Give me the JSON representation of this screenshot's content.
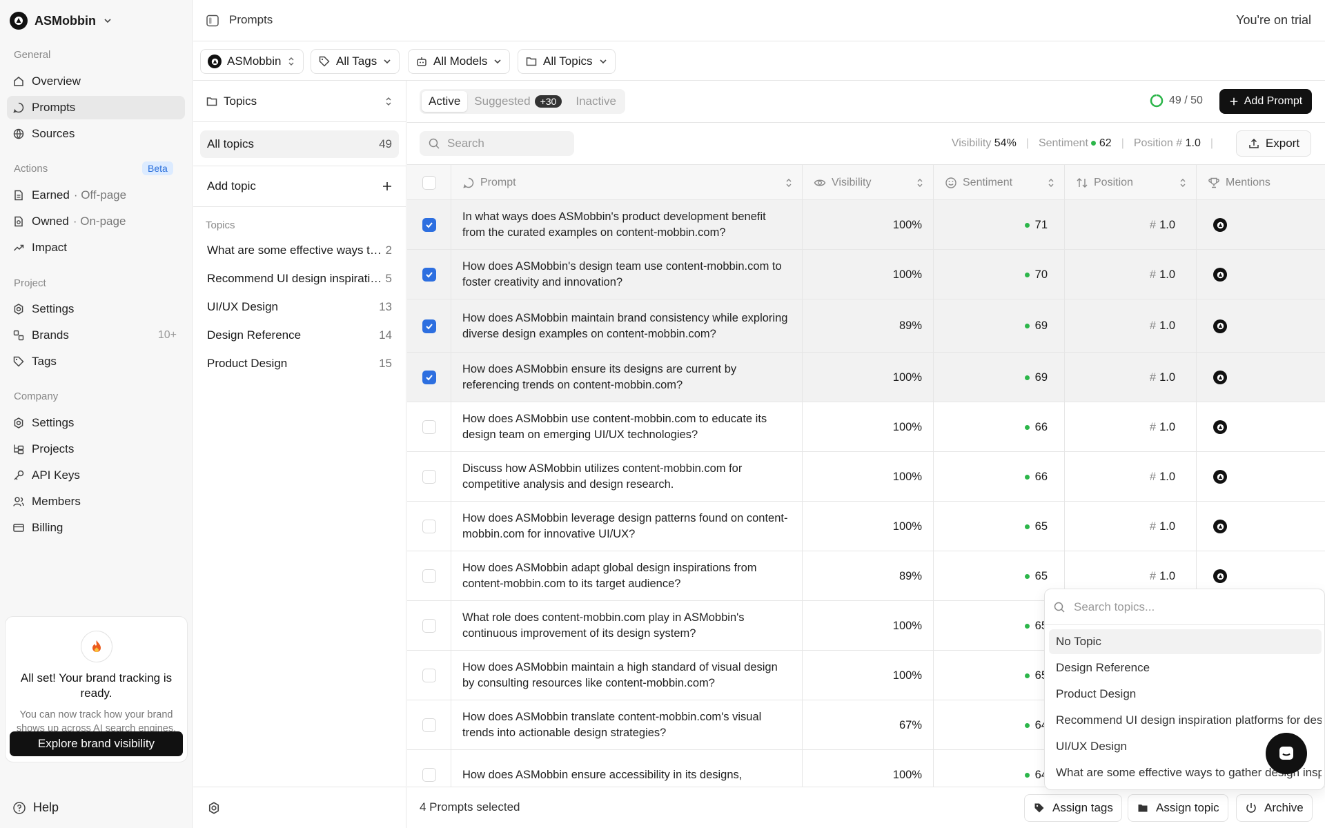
{
  "workspace": {
    "name": "ASMobbin"
  },
  "sidebar": {
    "general_label": "General",
    "general": [
      {
        "label": "Overview"
      },
      {
        "label": "Prompts"
      },
      {
        "label": "Sources"
      }
    ],
    "actions_label": "Actions",
    "actions_badge": "Beta",
    "actions": [
      {
        "label": "Earned",
        "sub": "· Off-page"
      },
      {
        "label": "Owned",
        "sub": "· On-page"
      },
      {
        "label": "Impact"
      }
    ],
    "project_label": "Project",
    "project": [
      {
        "label": "Settings"
      },
      {
        "label": "Brands",
        "count": "10+"
      },
      {
        "label": "Tags"
      }
    ],
    "company_label": "Company",
    "company": [
      {
        "label": "Settings"
      },
      {
        "label": "Projects"
      },
      {
        "label": "API Keys"
      },
      {
        "label": "Members"
      },
      {
        "label": "Billing"
      }
    ],
    "promo": {
      "title": "All set! Your brand tracking is ready.",
      "desc": "You can now track how your brand shows up across AI search engines.",
      "button": "Explore brand visibility"
    },
    "help": "Help"
  },
  "topbar": {
    "title": "Prompts",
    "trial": "You're on trial"
  },
  "filters": {
    "brand": "ASMobbin",
    "tags": "All Tags",
    "models": "All Models",
    "topics": "All Topics"
  },
  "topics_panel": {
    "header": "Topics",
    "all_label": "All topics",
    "all_count": "49",
    "add_label": "Add topic",
    "section_label": "Topics",
    "items": [
      {
        "label": "What are some effective ways to gather design inspiration",
        "count": "2"
      },
      {
        "label": "Recommend UI design inspiration platforms for designers",
        "count": "5"
      },
      {
        "label": "UI/UX Design",
        "count": "13"
      },
      {
        "label": "Design Reference",
        "count": "14"
      },
      {
        "label": "Product Design",
        "count": "15"
      }
    ]
  },
  "main": {
    "tabs": {
      "active": "Active",
      "suggested": "Suggested",
      "suggested_count": "+30",
      "inactive": "Inactive"
    },
    "quota": "49 / 50",
    "add_button": "Add Prompt",
    "search_placeholder": "Search",
    "metrics": {
      "visibility_label": "Visibility",
      "visibility_value": "54%",
      "sentiment_label": "Sentiment",
      "sentiment_value": "62",
      "position_label": "Position",
      "position_hash": "#",
      "position_value": "1.0"
    },
    "export_button": "Export",
    "columns": {
      "prompt": "Prompt",
      "visibility": "Visibility",
      "sentiment": "Sentiment",
      "position": "Position",
      "mentions": "Mentions"
    },
    "rows": [
      {
        "checked": true,
        "prompt": "In what ways does ASMobbin's product development benefit from the curated examples on content-mobbin.com?",
        "visibility": "100%",
        "sentiment": "71",
        "position": "1.0"
      },
      {
        "checked": true,
        "prompt": "How does ASMobbin's design team use content-mobbin.com to foster creativity and innovation?",
        "visibility": "100%",
        "sentiment": "70",
        "position": "1.0"
      },
      {
        "checked": true,
        "prompt": "How does ASMobbin maintain brand consistency while exploring diverse design examples on content-mobbin.com?",
        "visibility": "89%",
        "sentiment": "69",
        "position": "1.0"
      },
      {
        "checked": true,
        "prompt": "How does ASMobbin ensure its designs are current by referencing trends on content-mobbin.com?",
        "visibility": "100%",
        "sentiment": "69",
        "position": "1.0"
      },
      {
        "checked": false,
        "prompt": "How does ASMobbin use content-mobbin.com to educate its design team on emerging UI/UX technologies?",
        "visibility": "100%",
        "sentiment": "66",
        "position": "1.0"
      },
      {
        "checked": false,
        "prompt": "Discuss how ASMobbin utilizes content-mobbin.com for competitive analysis and design research.",
        "visibility": "100%",
        "sentiment": "66",
        "position": "1.0"
      },
      {
        "checked": false,
        "prompt": "How does ASMobbin leverage design patterns found on content-mobbin.com for innovative UI/UX?",
        "visibility": "100%",
        "sentiment": "65",
        "position": "1.0"
      },
      {
        "checked": false,
        "prompt": "How does ASMobbin adapt global design inspirations from content-mobbin.com to its target audience?",
        "visibility": "89%",
        "sentiment": "65",
        "position": "1.0"
      },
      {
        "checked": false,
        "prompt": "What role does content-mobbin.com play in ASMobbin's continuous improvement of its design system?",
        "visibility": "100%",
        "sentiment": "65",
        "position": ""
      },
      {
        "checked": false,
        "prompt": "How does ASMobbin maintain a high standard of visual design by consulting resources like content-mobbin.com?",
        "visibility": "100%",
        "sentiment": "65",
        "position": ""
      },
      {
        "checked": false,
        "prompt": "How does ASMobbin translate content-mobbin.com's visual trends into actionable design strategies?",
        "visibility": "67%",
        "sentiment": "64",
        "position": ""
      },
      {
        "checked": false,
        "prompt": "How does ASMobbin ensure accessibility in its designs,",
        "visibility": "100%",
        "sentiment": "64",
        "position": ""
      }
    ],
    "footer": {
      "selected": "4 Prompts selected",
      "assign_tags": "Assign tags",
      "assign_topic": "Assign topic",
      "archive": "Archive"
    }
  },
  "topic_dropdown": {
    "placeholder": "Search topics...",
    "items": [
      "No Topic",
      "Design Reference",
      "Product Design",
      "Recommend UI design inspiration platforms for designers",
      "UI/UX Design",
      "What are some effective ways to gather design inspiration"
    ]
  },
  "colors": {
    "accent": "#2d6fe0",
    "positive": "#2cb64a",
    "dark": "#111111"
  }
}
